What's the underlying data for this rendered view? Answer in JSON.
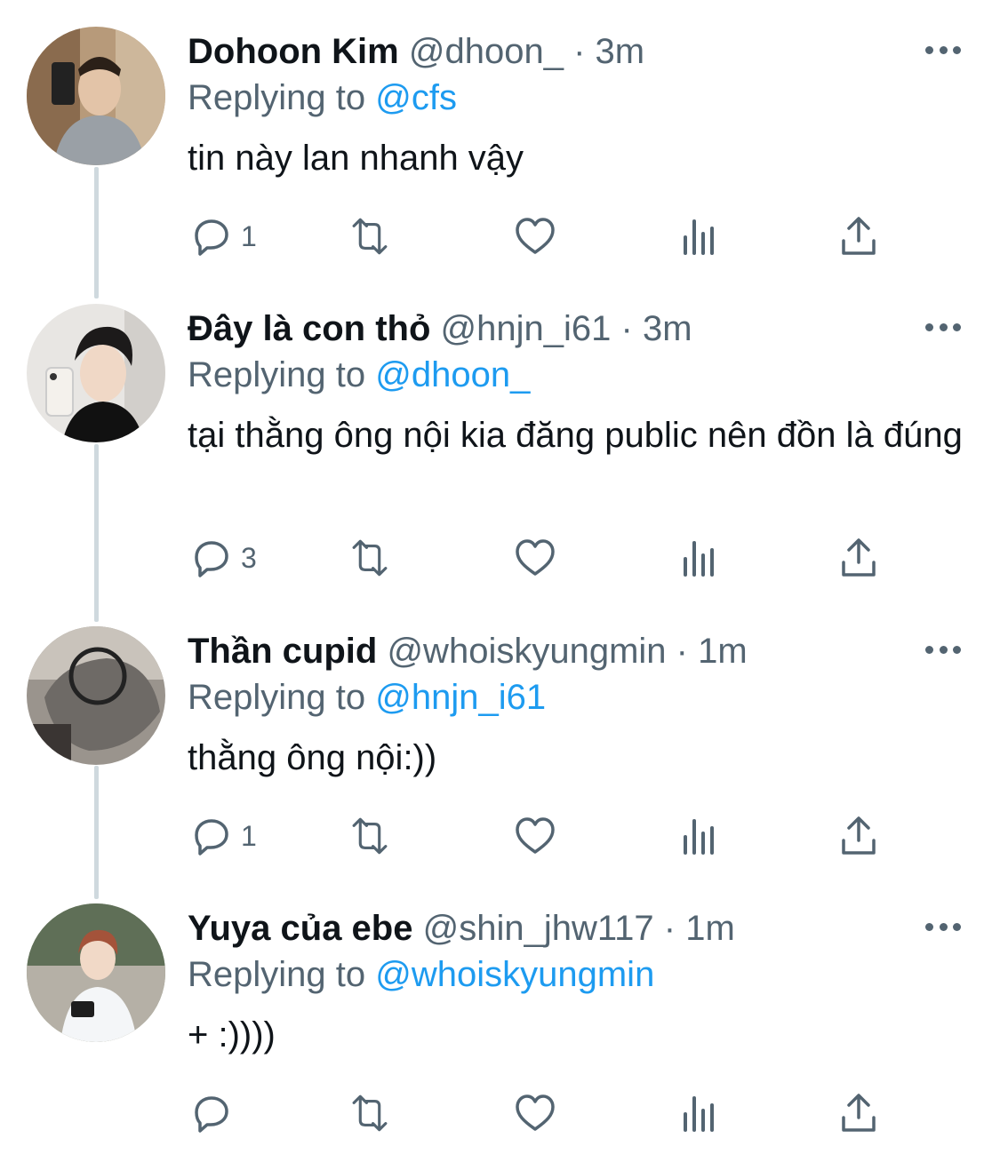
{
  "colors": {
    "text": "#0f1419",
    "secondary": "#536471",
    "link": "#1d9bf0",
    "thread_line": "#cfd9de"
  },
  "tweets": [
    {
      "name": "Dohoon Kim",
      "handle": "@dhoon_",
      "separator": "·",
      "time": "3m",
      "replying_prefix": "Replying to",
      "replying_to": "@cfs",
      "text": "tin này lan nhanh vậy",
      "reply_count": "1",
      "avatar_icon": "avatar-photo"
    },
    {
      "name": "Đây là con thỏ",
      "handle": "@hnjn_i61",
      "separator": "·",
      "time": "3m",
      "replying_prefix": "Replying to",
      "replying_to": "@dhoon_",
      "text": "tại thằng ông nội kia đăng public nên đồn là đúng",
      "reply_count": "3",
      "avatar_icon": "avatar-photo"
    },
    {
      "name": "Thần cupid",
      "handle": "@whoiskyungmin",
      "separator": "·",
      "time": "1m",
      "replying_prefix": "Replying to",
      "replying_to": "@hnjn_i61",
      "text": "thằng ông nội:))",
      "reply_count": "1",
      "avatar_icon": "avatar-photo"
    },
    {
      "name": "Yuya của ebe",
      "handle": "@shin_jhw117",
      "separator": "·",
      "time": "1m",
      "replying_prefix": "Replying to",
      "replying_to": "@whoiskyungmin",
      "text": "+ :))))",
      "reply_count": "",
      "avatar_icon": "avatar-photo"
    }
  ],
  "icons": {
    "reply": "reply-icon",
    "retweet": "retweet-icon",
    "like": "like-icon",
    "views": "views-icon",
    "share": "share-icon",
    "more": "more-icon"
  }
}
